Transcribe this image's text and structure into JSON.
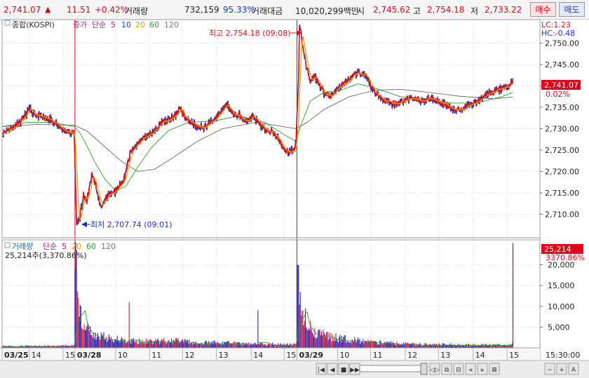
{
  "header": {
    "price": "2,741.07",
    "change_arrow": "▲",
    "change": "11.51",
    "change_pct": "+0.42%",
    "volume_label": "거래량",
    "volume": "732,159",
    "volume_ratio": "95.33%",
    "amount_label": "거래대금",
    "amount": "10,020,299백만",
    "open_label": "시",
    "open": "2,745.62",
    "high_label": "고",
    "high": "2,754.18",
    "low_label": "저",
    "low": "2,733.22",
    "buy_button": "매수",
    "sell_button": "매도"
  },
  "colors": {
    "price_line": "#d2141e",
    "price_line2": "#2030b8",
    "ma5": "#e8a000",
    "ma20": "#2e9a2e",
    "ma60": "#555555",
    "volume_bar": "#3a2fb5",
    "volume_bar_up": "#d23250",
    "session_line": "#e3001b"
  },
  "legend": {
    "title": "종합(KOSPI)",
    "price_label": "종가",
    "ma_label": "단순",
    "periods": [
      "5",
      "10",
      "20",
      "60",
      "120"
    ]
  },
  "volume_legend": {
    "title": "거래량",
    "ma_label": "단순",
    "periods": [
      "5",
      "20",
      "60",
      "120"
    ],
    "current": "25,214주(3,370.86%)"
  },
  "annotations": {
    "high": "최고 2,754.18 (09:08)",
    "low": "최저 2,707.74 (09:01)"
  },
  "right_panel": {
    "lc": "LC:1.23",
    "hc": "HC:-0.48",
    "current_price": "2,741.07",
    "current_pct": "0.02%",
    "current_volume": "25,214",
    "current_volume_pct": "3370.86%"
  },
  "chart_data": {
    "type": "line",
    "price_axis": {
      "ticks": [
        "2,750.00",
        "2,745.00",
        "2,740.00",
        "2,735.00",
        "2,730.00",
        "2,725.00",
        "2,720.00",
        "2,715.00",
        "2,710.00"
      ],
      "tick_values": [
        2750,
        2745,
        2740,
        2735,
        2730,
        2725,
        2720,
        2715,
        2710
      ],
      "ylim": [
        2704.5,
        2755.5
      ]
    },
    "volume_axis": {
      "ticks": [
        "20,000",
        "15,000",
        "10,000",
        "5,000"
      ],
      "tick_values": [
        20000,
        15000,
        10000,
        5000
      ],
      "ylim": [
        0,
        26000
      ]
    },
    "time_axis": {
      "labels": [
        {
          "t": 0,
          "label": "03/25",
          "bold": true
        },
        {
          "t": 32,
          "label": "14",
          "bold": false
        },
        {
          "t": 72,
          "label": "15",
          "bold": false
        },
        {
          "t": 86,
          "label": "03/28",
          "bold": true
        },
        {
          "t": 134,
          "label": "10",
          "bold": false
        },
        {
          "t": 174,
          "label": "11",
          "bold": false
        },
        {
          "t": 213,
          "label": "12",
          "bold": false
        },
        {
          "t": 253,
          "label": "13",
          "bold": false
        },
        {
          "t": 294,
          "label": "14",
          "bold": false
        },
        {
          "t": 333,
          "label": "15",
          "bold": false
        },
        {
          "t": 348,
          "label": "03/29",
          "bold": true
        },
        {
          "t": 396,
          "label": "10",
          "bold": false
        },
        {
          "t": 435,
          "label": "11",
          "bold": false
        },
        {
          "t": 476,
          "label": "12",
          "bold": false
        },
        {
          "t": 515,
          "label": "13",
          "bold": false
        },
        {
          "t": 556,
          "label": "14",
          "bold": false
        },
        {
          "t": 596,
          "label": "15",
          "bold": false
        }
      ],
      "end_label": "15:30:00",
      "t_range": [
        0,
        610
      ]
    },
    "session_starts": [
      86,
      348
    ],
    "high": {
      "t": 351,
      "value": 2754.18
    },
    "low": {
      "t": 88,
      "value": 2707.74
    },
    "close_path": [
      [
        0,
        2729.0
      ],
      [
        10,
        2730.0
      ],
      [
        22,
        2731.5
      ],
      [
        32,
        2734.5
      ],
      [
        44,
        2732.8
      ],
      [
        58,
        2732.0
      ],
      [
        68,
        2730.5
      ],
      [
        74,
        2729.5
      ],
      [
        82,
        2729.0
      ],
      [
        85,
        2729.5
      ],
      [
        86,
        2722.0
      ],
      [
        88,
        2707.74
      ],
      [
        92,
        2709.5
      ],
      [
        96,
        2714.5
      ],
      [
        100,
        2713.0
      ],
      [
        106,
        2719.5
      ],
      [
        110,
        2717.0
      ],
      [
        114,
        2713.5
      ],
      [
        118,
        2711.5
      ],
      [
        122,
        2713.5
      ],
      [
        128,
        2715.0
      ],
      [
        134,
        2715.5
      ],
      [
        140,
        2717.0
      ],
      [
        144,
        2718.5
      ],
      [
        148,
        2721.5
      ],
      [
        152,
        2724.5
      ],
      [
        160,
        2726.5
      ],
      [
        168,
        2728.0
      ],
      [
        174,
        2728.8
      ],
      [
        180,
        2729.5
      ],
      [
        188,
        2731.5
      ],
      [
        196,
        2731.8
      ],
      [
        204,
        2733.0
      ],
      [
        210,
        2734.8
      ],
      [
        216,
        2732.5
      ],
      [
        224,
        2731.5
      ],
      [
        232,
        2730.0
      ],
      [
        240,
        2730.5
      ],
      [
        248,
        2731.8
      ],
      [
        254,
        2733.0
      ],
      [
        260,
        2734.5
      ],
      [
        266,
        2735.5
      ],
      [
        272,
        2733.5
      ],
      [
        280,
        2733.0
      ],
      [
        288,
        2731.5
      ],
      [
        296,
        2733.0
      ],
      [
        304,
        2731.0
      ],
      [
        312,
        2729.5
      ],
      [
        320,
        2729.0
      ],
      [
        328,
        2727.0
      ],
      [
        334,
        2725.0
      ],
      [
        340,
        2724.5
      ],
      [
        344,
        2725.0
      ],
      [
        347,
        2726.5
      ],
      [
        348,
        2732.5
      ],
      [
        350,
        2742.0
      ],
      [
        351,
        2754.18
      ],
      [
        353,
        2752.0
      ],
      [
        356,
        2748.0
      ],
      [
        360,
        2744.0
      ],
      [
        364,
        2741.0
      ],
      [
        368,
        2742.5
      ],
      [
        374,
        2740.5
      ],
      [
        380,
        2738.5
      ],
      [
        388,
        2737.5
      ],
      [
        396,
        2739.5
      ],
      [
        404,
        2740.5
      ],
      [
        412,
        2742.0
      ],
      [
        420,
        2743.0
      ],
      [
        428,
        2742.5
      ],
      [
        434,
        2740.5
      ],
      [
        440,
        2738.5
      ],
      [
        448,
        2737.0
      ],
      [
        456,
        2736.5
      ],
      [
        464,
        2735.8
      ],
      [
        472,
        2736.5
      ],
      [
        480,
        2737.0
      ],
      [
        488,
        2737.2
      ],
      [
        496,
        2736.5
      ],
      [
        504,
        2737.0
      ],
      [
        512,
        2736.8
      ],
      [
        520,
        2736.0
      ],
      [
        528,
        2735.0
      ],
      [
        536,
        2734.5
      ],
      [
        544,
        2734.8
      ],
      [
        552,
        2735.5
      ],
      [
        560,
        2736.0
      ],
      [
        568,
        2737.5
      ],
      [
        576,
        2738.5
      ],
      [
        584,
        2739.0
      ],
      [
        592,
        2739.5
      ],
      [
        598,
        2740.0
      ],
      [
        603,
        2741.07
      ]
    ],
    "ma20_path": [
      [
        0,
        2730.5
      ],
      [
        30,
        2731.5
      ],
      [
        60,
        2731.5
      ],
      [
        85,
        2730.5
      ],
      [
        92,
        2729.0
      ],
      [
        100,
        2726.0
      ],
      [
        110,
        2722.0
      ],
      [
        122,
        2718.0
      ],
      [
        134,
        2715.5
      ],
      [
        146,
        2716.5
      ],
      [
        160,
        2721.0
      ],
      [
        176,
        2725.5
      ],
      [
        196,
        2729.5
      ],
      [
        220,
        2731.5
      ],
      [
        250,
        2731.8
      ],
      [
        280,
        2733.0
      ],
      [
        310,
        2731.5
      ],
      [
        334,
        2728.5
      ],
      [
        347,
        2727.0
      ],
      [
        352,
        2730.5
      ],
      [
        364,
        2736.5
      ],
      [
        380,
        2738.5
      ],
      [
        400,
        2739.0
      ],
      [
        420,
        2740.5
      ],
      [
        440,
        2739.5
      ],
      [
        470,
        2737.5
      ],
      [
        500,
        2737.0
      ],
      [
        530,
        2736.0
      ],
      [
        560,
        2736.0
      ],
      [
        590,
        2737.5
      ],
      [
        603,
        2738.5
      ]
    ],
    "ma60_path": [
      [
        0,
        2730.5
      ],
      [
        40,
        2731.0
      ],
      [
        85,
        2730.8
      ],
      [
        100,
        2729.5
      ],
      [
        120,
        2726.0
      ],
      [
        140,
        2722.5
      ],
      [
        160,
        2720.0
      ],
      [
        180,
        2720.5
      ],
      [
        200,
        2723.0
      ],
      [
        230,
        2727.0
      ],
      [
        260,
        2730.0
      ],
      [
        300,
        2731.5
      ],
      [
        347,
        2730.0
      ],
      [
        360,
        2731.5
      ],
      [
        380,
        2734.5
      ],
      [
        410,
        2737.5
      ],
      [
        440,
        2739.0
      ],
      [
        470,
        2739.2
      ],
      [
        500,
        2738.6
      ],
      [
        540,
        2737.6
      ],
      [
        580,
        2737.0
      ],
      [
        603,
        2737.4
      ]
    ],
    "volume_path": [
      [
        0,
        400
      ],
      [
        40,
        450
      ],
      [
        85,
        500
      ],
      [
        86,
        18000
      ],
      [
        87,
        23000
      ],
      [
        89,
        13000
      ],
      [
        92,
        9000
      ],
      [
        96,
        5500
      ],
      [
        102,
        4000
      ],
      [
        112,
        3000
      ],
      [
        130,
        2200
      ],
      [
        150,
        1800
      ],
      [
        175,
        1500
      ],
      [
        200,
        1800
      ],
      [
        230,
        1300
      ],
      [
        260,
        1200
      ],
      [
        290,
        1000
      ],
      [
        320,
        900
      ],
      [
        347,
        800
      ],
      [
        348,
        15000
      ],
      [
        349,
        24000
      ],
      [
        351,
        16000
      ],
      [
        354,
        10000
      ],
      [
        358,
        7000
      ],
      [
        364,
        5000
      ],
      [
        372,
        3500
      ],
      [
        390,
        2600
      ],
      [
        410,
        2000
      ],
      [
        440,
        1400
      ],
      [
        470,
        1000
      ],
      [
        500,
        850
      ],
      [
        530,
        750
      ],
      [
        560,
        700
      ],
      [
        590,
        650
      ],
      [
        602,
        700
      ],
      [
        603,
        25214
      ]
    ],
    "volume_spikes": [
      {
        "t": 150,
        "value": 11000
      },
      {
        "t": 302,
        "value": 9000
      },
      {
        "t": 358,
        "value": 9500
      }
    ]
  },
  "toolbar": {
    "items": [
      "|◀◀",
      "◀",
      "■",
      "▶▶|",
      "◁▷",
      "⧉",
      "⊟",
      "⫷",
      "⫸",
      "⊠",
      "−",
      "+",
      "A"
    ]
  }
}
